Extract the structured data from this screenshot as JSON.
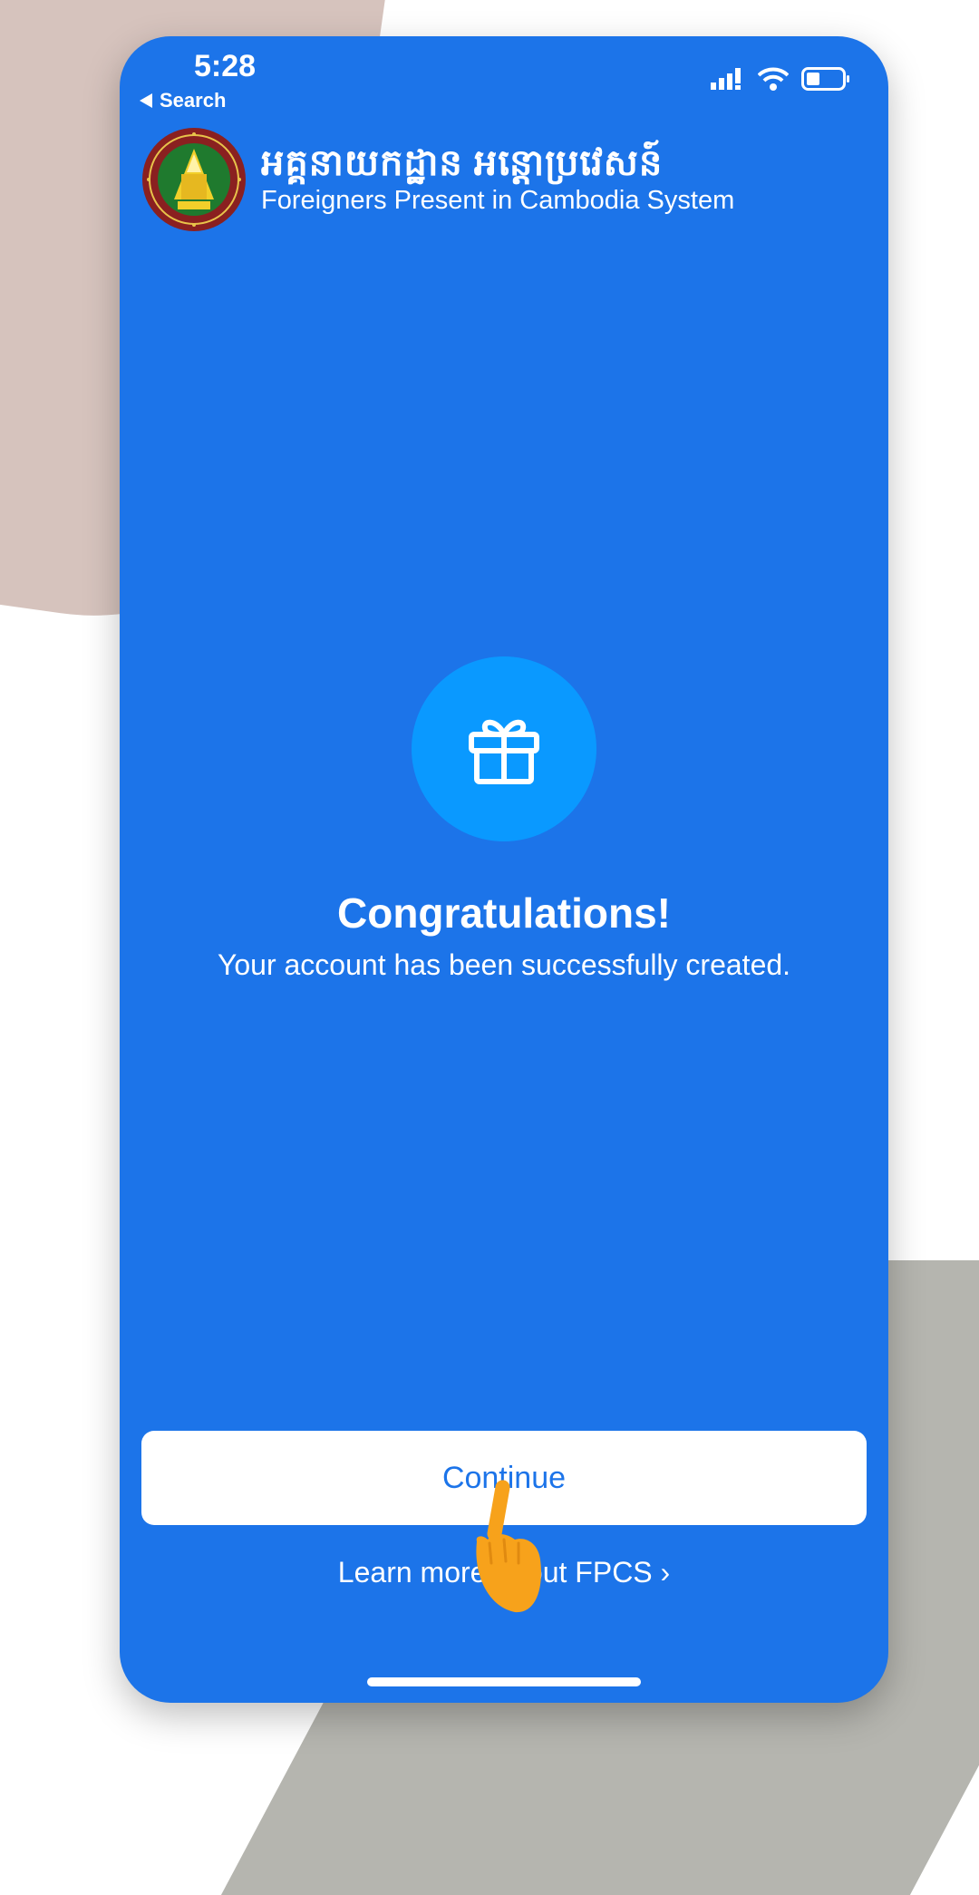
{
  "status_bar": {
    "time": "5:28",
    "back_label": "Search",
    "icons": [
      "signal-icon",
      "wifi-icon",
      "battery-icon"
    ]
  },
  "header": {
    "title_khmer": "អគ្គនាយកដ្ឋាន អន្តោប្រវេសន៍",
    "title_english": "Foreigners Present in Cambodia System",
    "emblem": "immigration-emblem"
  },
  "main": {
    "icon": "gift-icon",
    "title": "Congratulations!",
    "message": "Your account has been successfully created."
  },
  "actions": {
    "continue_label": "Continue",
    "learn_more_label": "Learn more about FPCS",
    "learn_more_chevron": "›"
  },
  "overlay": {
    "pointer": "hand-pointer-icon"
  },
  "colors": {
    "primary_blue": "#1c74e9",
    "gift_circle": "#0a99ff",
    "pointer_orange": "#f7a21b",
    "background_pink": "#d6c3bd",
    "background_gray": "#b5b5af"
  }
}
